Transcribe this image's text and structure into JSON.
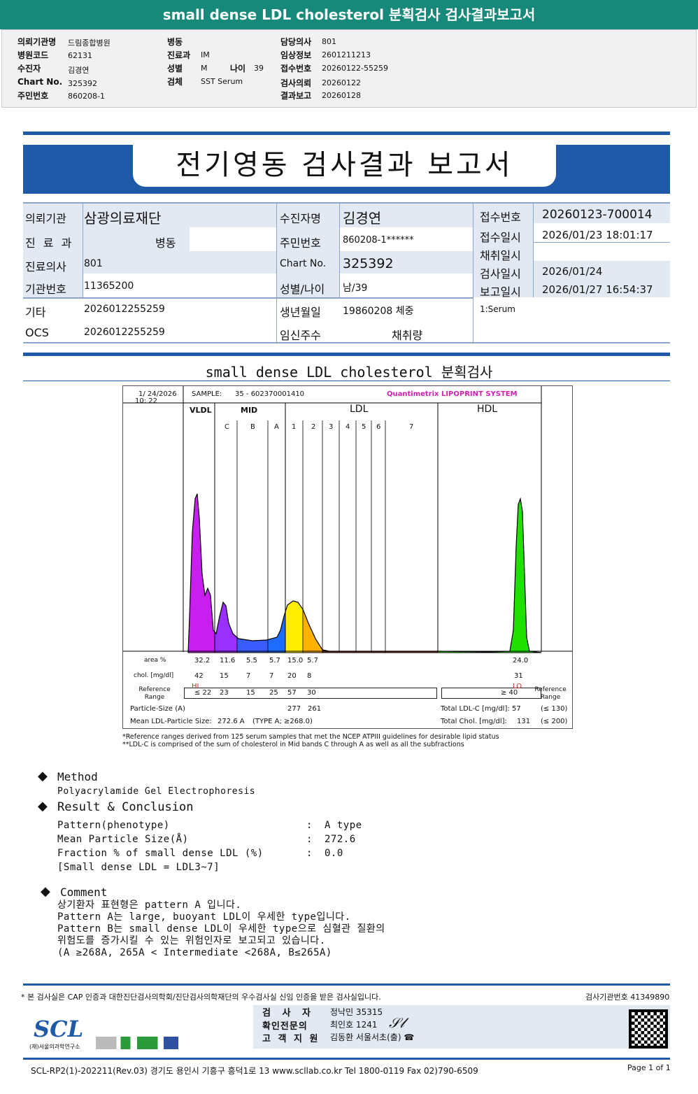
{
  "title": "small dense LDL cholesterol 분획검사 검사결과보고서",
  "info": {
    "hospital_label": "의뢰기관명",
    "hospital": "드림종합병원",
    "code_label": "병원코드",
    "code": "62131",
    "patient_label": "수진자",
    "patient": "김경연",
    "chart_label": "Chart No.",
    "chart": "325392",
    "rrn_label": "주민번호",
    "rrn": "860208-1",
    "ward_label": "병동",
    "ward": "",
    "dept_label": "진료과",
    "dept": "IM",
    "sex_label": "성별",
    "sex": "M",
    "age_label": "나이",
    "age": "39",
    "specimen_label": "검체",
    "specimen": "SST Serum",
    "doctor_label": "담당의사",
    "doctor": "801",
    "clinical_label": "임상정보",
    "clinical": "2601211213",
    "receipt_label": "접수번호",
    "receipt": "20260122-55259",
    "request_label": "검사의뢰",
    "request": "20260122",
    "report_label": "결과보고",
    "report": "20260128"
  },
  "report_title": "전기영동 검사결과 보고서",
  "ptable": {
    "r1": [
      "의뢰기관",
      "삼광의료재단",
      "수진자명",
      "김경연"
    ],
    "r2": [
      "진 료 과",
      "병동",
      "주민번호",
      "860208-1******"
    ],
    "r3": [
      "진료의사",
      "801",
      "Chart No.",
      "325392"
    ],
    "r4": [
      "기관번호",
      "11365200",
      "성별/나이",
      "남/39"
    ],
    "r5": [
      "기타",
      "2026012255259",
      "생년월일",
      "19860208 체중"
    ],
    "r6": [
      "OCS",
      "2026012255259",
      "임신주수",
      "채취량"
    ],
    "right": [
      [
        "접수번호",
        "20260123-700014"
      ],
      [
        "접수일시",
        "2026/01/23 18:01:17"
      ],
      [
        "채취일시",
        ""
      ],
      [
        "검사일시",
        "2026/01/24"
      ],
      [
        "보고일시",
        "2026/01/27 16:54:37"
      ]
    ],
    "specimen_note": "1:Serum"
  },
  "section_title": "small dense LDL cholesterol 분획검사",
  "chart_data": {
    "type": "area",
    "date": "1/ 24/2026",
    "time": "10: 22",
    "sample_label": "SAMPLE:",
    "sample": "35 - 602370001410",
    "brand": "Quantimetrix LIPOPRINT SYSTEM",
    "groups": [
      "VLDL",
      "MID",
      "LDL",
      "HDL"
    ],
    "subbands": [
      "C",
      "B",
      "A",
      "1",
      "2",
      "3",
      "4",
      "5",
      "6",
      "7"
    ],
    "colors": {
      "VLDL": "#c81ef0",
      "C": "#9a30ff",
      "B": "#3a5cff",
      "A": "#1e6cff",
      "1": "#ffee00",
      "2": "#ffb000",
      "rest": "#7a3030",
      "HDL": "#20e000"
    },
    "row_labels": {
      "area": "area %",
      "chol": "chol. [mg/dl]",
      "ref": "Reference Range",
      "ref_right": "Reference Range",
      "psize": "Particle-Size (A)",
      "mean": "Mean LDL-Particle Size:"
    },
    "area": [
      "32.2",
      "11.6",
      "5.5",
      "5.7",
      "15.0",
      "5.7"
    ],
    "hdl_area": "24.0",
    "chol": [
      "42",
      "15",
      "7",
      "7",
      "20",
      "8"
    ],
    "hdl_chol": "31",
    "flag": "HI",
    "hdl_flag": "LO",
    "ref": [
      "≤ 22",
      "23",
      "15",
      "25",
      "57",
      "30"
    ],
    "hdl_ref": "≥  40",
    "psize": [
      "277",
      "261"
    ],
    "mean": "272.6  A",
    "mean_type": "(TYPE A; ≥268.0)",
    "total_ldl_label": "Total LDL-C [mg/dl]:",
    "total_ldl": "57",
    "total_ldl_ref": "(≤ 130)",
    "total_chol_label": "Total Chol. [mg/dl]:",
    "total_chol": "131",
    "total_chol_ref": "(≤ 200)"
  },
  "footnotes": [
    "*Reference ranges derived from 125 serum samples that met the NCEP ATPIII guidelines for desirable lipid status",
    "**LDL-C is comprised of the sum of cholesterol in Mid bands C through A as well as all the subfractions"
  ],
  "method": {
    "title": "Method",
    "text": "Polyacrylamide Gel Electrophoresis"
  },
  "result": {
    "title": "Result & Conclusion",
    "rows": [
      [
        "Pattern(phenotype)",
        ":",
        "A type"
      ],
      [
        "Mean Particle Size(Å)",
        ":",
        "272.6"
      ],
      [
        "Fraction % of small dense LDL (%)",
        ":",
        "0.0"
      ]
    ],
    "note": "[Small dense LDL = LDL3~7]"
  },
  "comment": {
    "title": "Comment",
    "lines": [
      "상기환자 표현형은 pattern A 입니다.",
      "Pattern A는 large, buoyant LDL이 우세한 type입니다.",
      "Pattern B는 small dense LDL이 우세한 type으로 심혈관 질환의",
      "위험도를 증가시킬 수 있는 위험인자로 보고되고 있습니다.",
      "(A ≥268A, 265A < Intermediate <268A, B≤265A)"
    ]
  },
  "footer": {
    "cert": "* 본 검사실은 CAP 인증과 대한진단검사의학회/진단검사의학재단의 우수검사실 신임 인증을 받은 검사실입니다.",
    "lab_no": "검사기관번호 41349890",
    "tester_label": "검 사 자",
    "tester": "정낙민 35315",
    "confirm_label": "확인전문의",
    "confirm": "최인호 1241",
    "support_label": "고 객 지 원",
    "support": "김동환 서울서초(출) ☎",
    "logo": "SCL",
    "logo_sub": "(재)서울의과학연구소",
    "address": "SCL-RP2(1)-202211(Rev.03)  경기도 용인시 기흥구 흥덕1로 13   www.scllab.co.kr   Tel 1800-0119   Fax 02)790-6509",
    "page": "Page 1 of 1"
  }
}
